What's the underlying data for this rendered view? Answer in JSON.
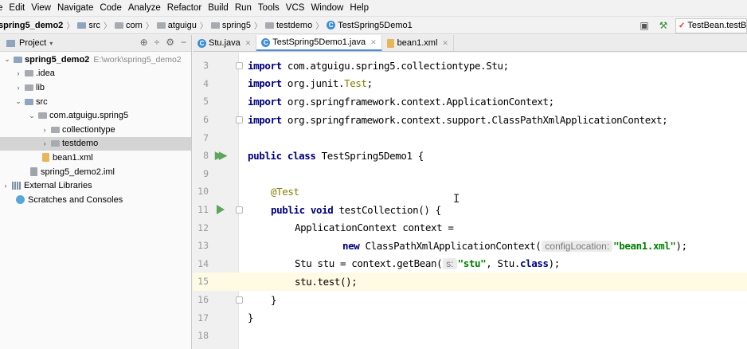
{
  "menu": [
    "e",
    "Edit",
    "View",
    "Navigate",
    "Code",
    "Analyze",
    "Refactor",
    "Build",
    "Run",
    "Tools",
    "VCS",
    "Window",
    "Help"
  ],
  "breadcrumbs": [
    "spring5_demo2",
    "src",
    "com",
    "atguigu",
    "spring5",
    "testdemo",
    "TestSpring5Demo1"
  ],
  "run_config": "TestBean.testB",
  "project_panel": {
    "title": "Project",
    "tree": [
      {
        "label": "spring5_demo2",
        "path": "E:\\work\\spring5_demo2"
      },
      {
        "label": ".idea"
      },
      {
        "label": "lib"
      },
      {
        "label": "src"
      },
      {
        "label": "com.atguigu.spring5"
      },
      {
        "label": "collectiontype"
      },
      {
        "label": "testdemo"
      },
      {
        "label": "bean1.xml"
      },
      {
        "label": "spring5_demo2.iml"
      },
      {
        "label": "External Libraries"
      },
      {
        "label": "Scratches and Consoles"
      }
    ]
  },
  "tabs": [
    {
      "label": "Stu.java"
    },
    {
      "label": "TestSpring5Demo1.java"
    },
    {
      "label": "bean1.xml"
    }
  ],
  "editor": {
    "line_numbers": [
      "3",
      "4",
      "5",
      "6",
      "7",
      "8",
      "9",
      "10",
      "11",
      "12",
      "13",
      "14",
      "15",
      "16",
      "17",
      "18"
    ],
    "lines": {
      "l3": {
        "kw": "import",
        "rest": " com.atguigu.spring5.collectiontype.Stu;"
      },
      "l4": {
        "kw": "import",
        "pkg": " org.junit.",
        "cls": "Test",
        "end": ";"
      },
      "l5": {
        "kw": "import",
        "rest": " org.springframework.context.ApplicationContext;"
      },
      "l6": {
        "kw": "import",
        "rest": " org.springframework.context.support.ClassPathXmlApplicationContext;"
      },
      "l8": {
        "kw": "public class",
        "rest": " TestSpring5Demo1 {"
      },
      "l10": {
        "ann": "@Test"
      },
      "l11": {
        "kw": "public void",
        "rest": " testCollection() {"
      },
      "l12": {
        "rest": "ApplicationContext context ="
      },
      "l13": {
        "kw": "new",
        "rest": " ClassPathXmlApplicationContext(",
        "hint": "configLocation:",
        "str": "\"bean1.xml\"",
        "end": ");"
      },
      "l14": {
        "pre": "Stu stu = context.getBean(",
        "hint": "s:",
        "str": "\"stu\"",
        "mid": ", Stu.",
        "kw": "class",
        "end": ");"
      },
      "l15": {
        "rest": "stu.test();"
      },
      "l16": {
        "rest": "}"
      },
      "l17": {
        "rest": "}"
      }
    }
  }
}
